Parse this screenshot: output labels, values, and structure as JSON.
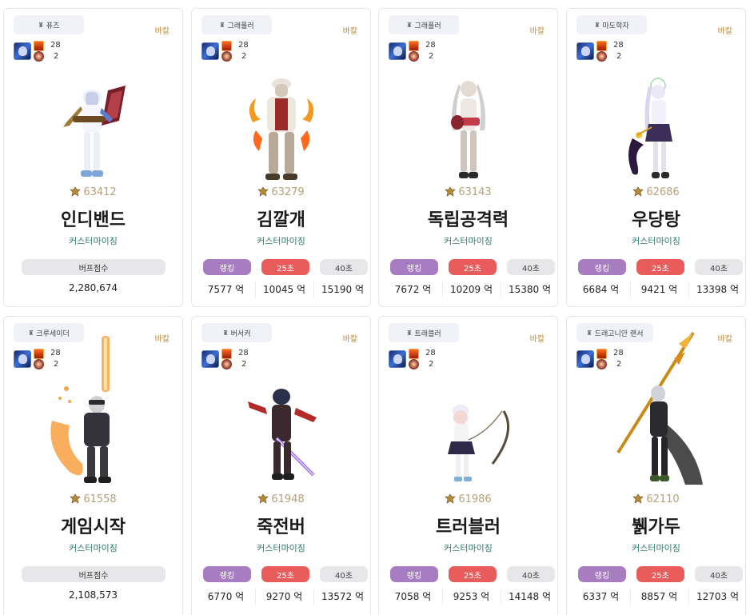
{
  "cards": [
    {
      "job": "퓨즈",
      "server": "바칼",
      "equip_count": "28",
      "equip_sub": "2",
      "fame": "63412",
      "name": "인디밴드",
      "adventure": "커스터마이징",
      "type": "buff",
      "buff_label": "버프점수",
      "buff_value": "2,280,674"
    },
    {
      "job": "그래플러",
      "server": "바칼",
      "equip_count": "28",
      "equip_sub": "2",
      "fame": "63279",
      "name": "김깔개",
      "adventure": "커스터마이징",
      "type": "dmg",
      "labels": [
        "랭킹",
        "25초",
        "40초"
      ],
      "values": [
        "7577 억",
        "10045 억",
        "15190 억"
      ]
    },
    {
      "job": "그래플러",
      "server": "바칼",
      "equip_count": "28",
      "equip_sub": "2",
      "fame": "63143",
      "name": "독립공격력",
      "adventure": "커스터마이징",
      "type": "dmg",
      "labels": [
        "랭킹",
        "25초",
        "40초"
      ],
      "values": [
        "7672 억",
        "10209 억",
        "15380 억"
      ]
    },
    {
      "job": "마도학자",
      "server": "바칼",
      "equip_count": "28",
      "equip_sub": "2",
      "fame": "62686",
      "name": "우당탕",
      "adventure": "커스터마이징",
      "type": "dmg",
      "labels": [
        "랭킹",
        "25초",
        "40초"
      ],
      "values": [
        "6684 억",
        "9421 억",
        "13398 억"
      ]
    },
    {
      "job": "크루세이더",
      "server": "바칼",
      "equip_count": "28",
      "equip_sub": "2",
      "fame": "61558",
      "name": "게임시작",
      "adventure": "커스터마이징",
      "type": "buff",
      "buff_label": "버프점수",
      "buff_value": "2,108,573"
    },
    {
      "job": "버서커",
      "server": "바칼",
      "equip_count": "28",
      "equip_sub": "2",
      "fame": "61948",
      "name": "죽전버",
      "adventure": "커스터마이징",
      "type": "dmg",
      "labels": [
        "랭킹",
        "25초",
        "40초"
      ],
      "values": [
        "6770 억",
        "9270 억",
        "13572 억"
      ]
    },
    {
      "job": "트래블러",
      "server": "바칼",
      "equip_count": "28",
      "equip_sub": "2",
      "fame": "61986",
      "name": "트러블러",
      "adventure": "커스터마이징",
      "type": "dmg",
      "labels": [
        "랭킹",
        "25초",
        "40초"
      ],
      "values": [
        "7058 억",
        "9253 억",
        "14148 억"
      ]
    },
    {
      "job": "드래고니안 랜서",
      "server": "바칼",
      "equip_count": "28",
      "equip_sub": "2",
      "fame": "62110",
      "name": "뷁가두",
      "adventure": "커스터마이징",
      "type": "dmg",
      "labels": [
        "랭킹",
        "25초",
        "40초"
      ],
      "values": [
        "6337 억",
        "8857 억",
        "12703 억"
      ]
    }
  ],
  "icons": {
    "job_tag": "class-icon",
    "fame": "fame-medal-icon",
    "equip_main": "creature-icon",
    "equip_top": "title-icon",
    "equip_bottom": "aura-icon"
  },
  "colors": {
    "server": "#c0883d",
    "adventure": "#2f7a6a",
    "ranking": "#a87cc0",
    "sec25": "#e85c5c",
    "sec40": "#e7e7e9",
    "fame": "#b8a07a"
  }
}
